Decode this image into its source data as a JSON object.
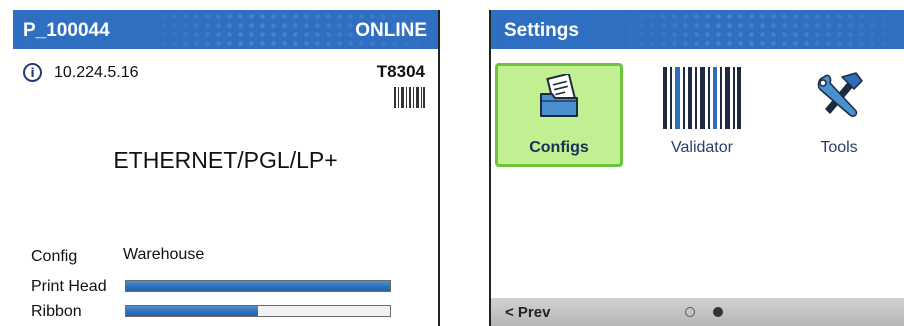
{
  "status_screen": {
    "title": "P_100044",
    "status": "ONLINE",
    "ip_address": "10.224.5.16",
    "model": "T8304",
    "protocol": "ETHERNET/PGL/LP+",
    "config": {
      "label": "Config",
      "value": "Warehouse"
    },
    "print_head": {
      "label": "Print Head",
      "level": 1.0
    },
    "ribbon": {
      "label": "Ribbon",
      "level": 0.5
    }
  },
  "settings_screen": {
    "title": "Settings",
    "tiles": [
      {
        "label": "Configs",
        "icon": "folder-document-icon",
        "selected": true
      },
      {
        "label": "Validator",
        "icon": "barcode-icon",
        "selected": false
      },
      {
        "label": "Tools",
        "icon": "wrench-hammer-icon",
        "selected": false
      }
    ],
    "prev_label": "< Prev",
    "pager": {
      "page_count": 2,
      "current_page": 2
    }
  },
  "colors": {
    "title_bar": "#2e6fc2",
    "selected_tile_fill": "#c3ef93",
    "selected_tile_border": "#6dc23e",
    "bar_fill": "#2f6db8"
  }
}
